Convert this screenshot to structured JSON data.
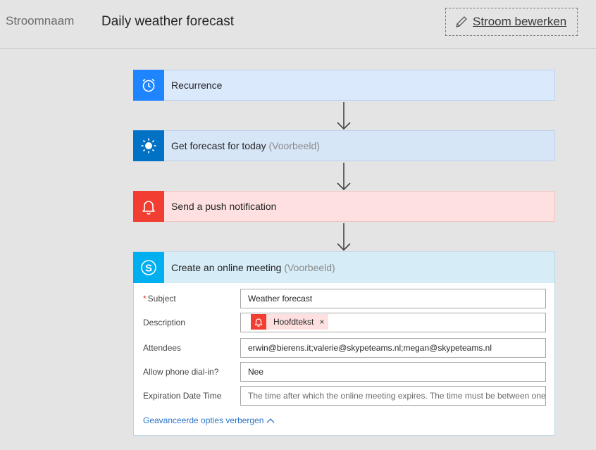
{
  "header": {
    "flow_name_label": "Stroomnaam",
    "flow_title": "Daily weather forecast",
    "edit_label": "Stroom bewerken"
  },
  "steps": [
    {
      "title": "Recurrence",
      "suffix": "",
      "icon": "alarm-clock-icon",
      "color": "#1f85ff"
    },
    {
      "title": "Get forecast for today",
      "suffix": "(Voorbeeld)",
      "icon": "sun-icon",
      "color": "#0072c6"
    },
    {
      "title": "Send a push notification",
      "suffix": "",
      "icon": "bell-icon",
      "color": "#f23e32"
    },
    {
      "title": "Create an online meeting",
      "suffix": "(Voorbeeld)",
      "icon": "skype-icon",
      "color": "#00aff0"
    }
  ],
  "meeting_form": {
    "subject": {
      "label": "Subject",
      "required": "*",
      "value": "Weather forecast"
    },
    "description": {
      "label": "Description",
      "token_label": "Hoofdtekst",
      "token_remove": "×"
    },
    "attendees": {
      "label": "Attendees",
      "value": "erwin@bierens.it;valerie@skypeteams.nl;megan@skypeteams.nl"
    },
    "phone_dialin": {
      "label": "Allow phone dial-in?",
      "value": "Nee"
    },
    "expiration": {
      "label": "Expiration Date Time",
      "placeholder": "The time after which the online meeting expires. The time must be between one hour and one year from now."
    },
    "advanced_toggle": "Geavanceerde opties verbergen"
  }
}
